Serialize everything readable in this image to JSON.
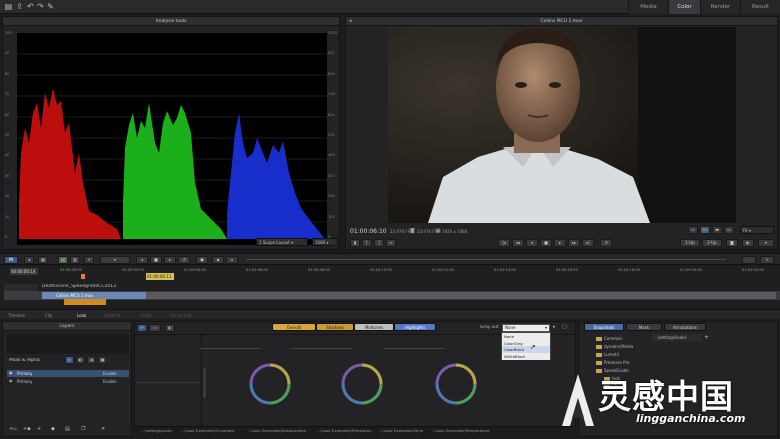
{
  "toolbar": {
    "icons": [
      "folder-open-icon",
      "export-icon",
      "undo-icon",
      "redo-icon",
      "wrench-icon"
    ]
  },
  "workspace_tabs": [
    {
      "label": "Media",
      "active": false
    },
    {
      "label": "Color",
      "active": true
    },
    {
      "label": "Render",
      "active": false
    },
    {
      "label": "Result",
      "active": false
    }
  ],
  "scopes": {
    "title": "Analysis tools",
    "left_ticks": [
      "100",
      "90",
      "80",
      "70",
      "60",
      "50",
      "40",
      "30",
      "20",
      "10",
      "0"
    ],
    "right_ticks": [
      "1023",
      "921",
      "819",
      "716",
      "614",
      "512",
      "409",
      "307",
      "204",
      "102",
      "0"
    ],
    "layout_select": "1 Scope Layout",
    "mode_select": "1080"
  },
  "viewer": {
    "title": "Collins MCU 1.mov",
    "timecode": "01:00:06:10",
    "info_fps_a": "23.976 FPS",
    "info_fps_b": "23.976 FPS",
    "resolution": "1920 x 1080",
    "fit_select": "Fit",
    "btn_1up": "1-Up",
    "btn_2up": "2-Up"
  },
  "timeline": {
    "in_label": "IN",
    "start_tc": "00:00:00:14",
    "cursor_tc": "01:00:06:11",
    "ruler": [
      "01:00:00:00",
      "01:00:02:00",
      "01:00:04:00",
      "01:00:06:00",
      "01:00:08:00",
      "01:00:10:00",
      "01:00:12:00",
      "01:00:14:00",
      "01:00:16:00",
      "01:00:18:00",
      "01:00:20:00",
      "01:00:22:00"
    ],
    "track_name": "Deathscene_SpeedgradeCC2013",
    "clip_name": "Collins MCU 1.mov"
  },
  "bottom_tabs": [
    "Timeline",
    "Clip",
    "Look",
    "Audio M.",
    "Audio",
    "Sound Lab"
  ],
  "layers": {
    "title": "Layers",
    "mask_label": "Mask & Alpha",
    "rows": [
      {
        "name": "Primary",
        "enable": "Enable"
      },
      {
        "name": "Primary",
        "enable": "Enable"
      }
    ]
  },
  "look_controls": {
    "tabs": [
      "Overall",
      "Shadows",
      "Midtones",
      "Highlights"
    ],
    "gray_label": "Gray out",
    "gray_options": [
      "None",
      "ColorGray",
      "ColorBlack",
      "WhiteBlack"
    ],
    "gray_selected": "None",
    "row_labels": [
      "Lift",
      "Gamma",
      "Gain"
    ]
  },
  "browser": {
    "tabs": [
      "Snapshots",
      "Mask",
      "Annotations"
    ],
    "folders": [
      "Common",
      "dynamicMedia",
      "Lumetri",
      "Premiere Pro",
      "SpeedGrade",
      "look",
      "LA"
    ],
    "path": "..\\settings\\looks"
  },
  "look_tabs": [
    "..\\settings\\looks",
    "..\\Look Examples\\Cinematic",
    "..\\Look Examples\\Desaturation",
    "..\\Look Examples\\Filmstocks",
    "..\\Look Examples\\Style",
    "..\\Look Examples\\Temperature"
  ],
  "watermark": {
    "brand": "灵感中国",
    "url": "lingganchina.com"
  }
}
